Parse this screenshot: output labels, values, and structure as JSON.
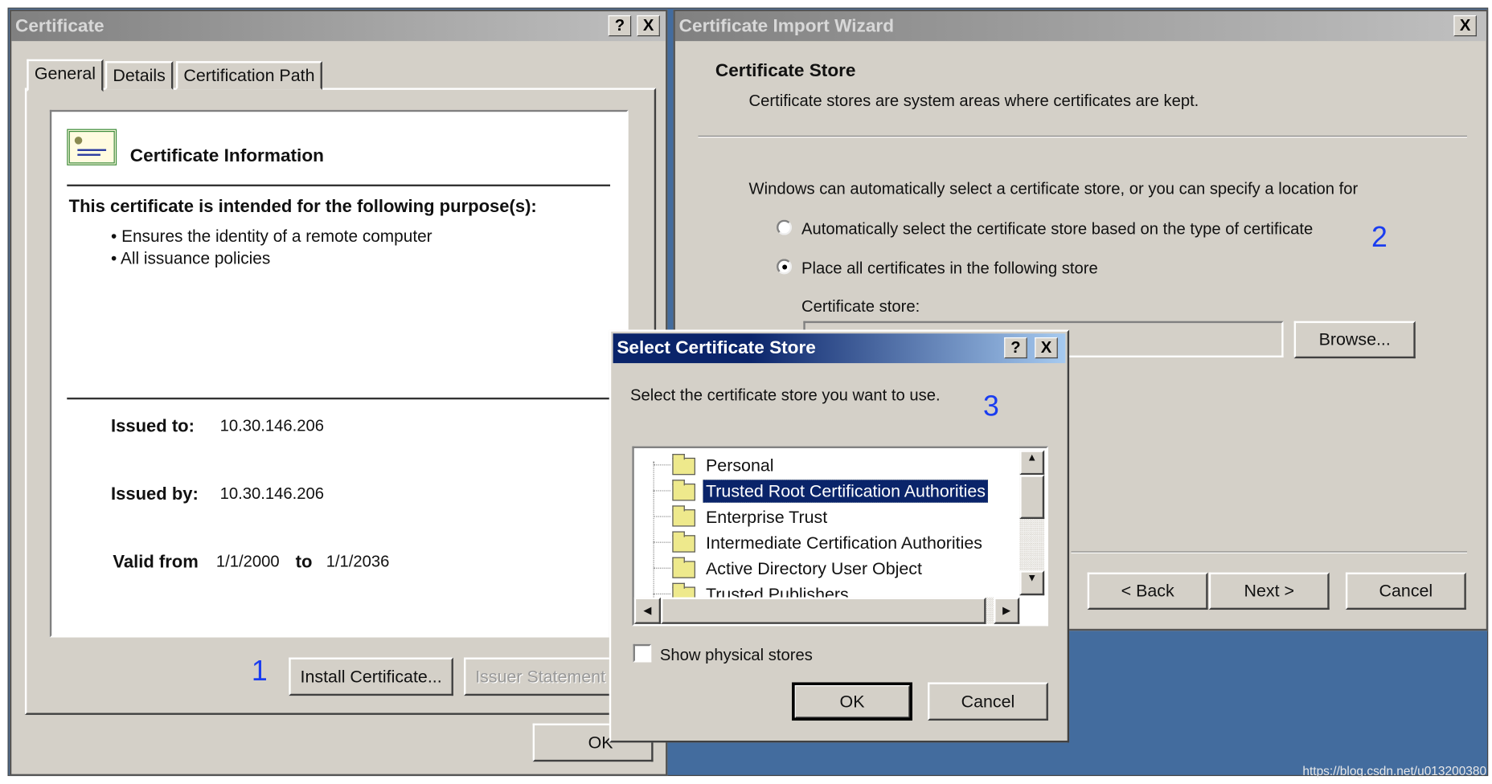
{
  "colors": {
    "desktop": "#436c9e",
    "dialog": "#d4d0c8",
    "active_title": "#0a246a",
    "annotation": "#1a3df0"
  },
  "certificate_dialog": {
    "title": "Certificate",
    "help_label": "?",
    "close_label": "X",
    "tabs": [
      {
        "label": "General",
        "selected": true
      },
      {
        "label": "Details"
      },
      {
        "label": "Certification Path"
      }
    ],
    "info_heading": "Certificate Information",
    "icon": "certificate-icon",
    "purpose_heading": "This certificate is intended for the following purpose(s):",
    "purposes": [
      "Ensures the identity of a remote computer",
      "All issuance policies"
    ],
    "issued_to_label": "Issued to:",
    "issued_to": "10.30.146.206",
    "issued_by_label": "Issued by:",
    "issued_by": "10.30.146.206",
    "valid_from_label": "Valid from",
    "valid_from": "1/1/2000",
    "to_label": "to",
    "valid_to": "1/1/2036",
    "annotation": "1",
    "install_button": "Install Certificate...",
    "issuer_statement_button": "Issuer Statement",
    "ok_button": "OK"
  },
  "import_wizard": {
    "title": "Certificate Import Wizard",
    "close_label": "X",
    "heading": "Certificate Store",
    "subheading": "Certificate stores are system areas where certificates are kept.",
    "intro": "Windows can automatically select a certificate store, or you can specify a location for",
    "radio_auto": "Automatically select the certificate store based on the type of certificate",
    "radio_place": "Place all certificates in the following store",
    "selected_option": "radio_place",
    "annotation": "2",
    "store_label": "Certificate store:",
    "store_value": "",
    "browse_button": "Browse...",
    "back_button": "< Back",
    "next_button": "Next >",
    "cancel_button": "Cancel"
  },
  "select_store": {
    "title": "Select Certificate Store",
    "help_label": "?",
    "close_label": "X",
    "prompt": "Select the certificate store you want to use.",
    "annotation": "3",
    "stores": [
      "Personal",
      "Trusted Root Certification Authorities",
      "Enterprise Trust",
      "Intermediate Certification Authorities",
      "Active Directory User Object",
      "Trusted Publishers"
    ],
    "selected_store": "Trusted Root Certification Authorities",
    "show_physical_label": "Show physical stores",
    "show_physical_checked": false,
    "ok_button": "OK",
    "cancel_button": "Cancel"
  },
  "watermark": "https://blog.csdn.net/u013200380"
}
